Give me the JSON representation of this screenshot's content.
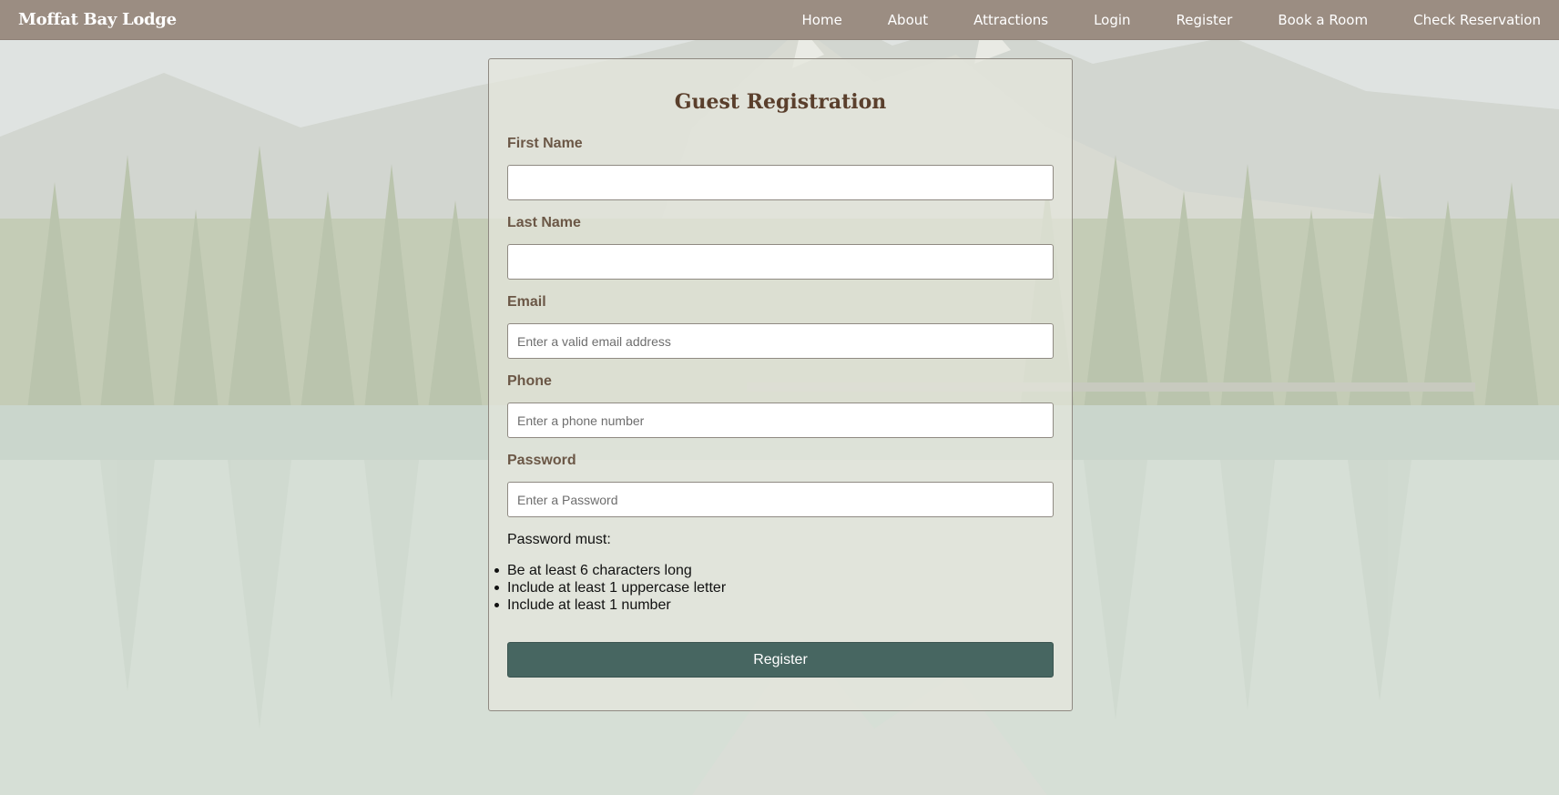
{
  "nav": {
    "brand": "Moffat Bay Lodge",
    "links": [
      {
        "label": "Home"
      },
      {
        "label": "About"
      },
      {
        "label": "Attractions"
      },
      {
        "label": "Login"
      },
      {
        "label": "Register"
      },
      {
        "label": "Book a Room"
      },
      {
        "label": "Check Reservation"
      }
    ]
  },
  "form": {
    "title": "Guest Registration",
    "fields": [
      {
        "label": "First Name",
        "value": "",
        "placeholder": ""
      },
      {
        "label": "Last Name",
        "value": "",
        "placeholder": ""
      },
      {
        "label": "Email",
        "value": "",
        "placeholder": "Enter a valid email address"
      },
      {
        "label": "Phone",
        "value": "",
        "placeholder": "Enter a phone number"
      },
      {
        "label": "Password",
        "value": "",
        "placeholder": "Enter a Password"
      }
    ],
    "password_rules_title": "Password must:",
    "password_rules": [
      "Be at least 6 characters long",
      "Include at least 1 uppercase letter",
      "Include at least 1 number"
    ],
    "submit_label": "Register"
  },
  "colors": {
    "navbar": "#9b8d82",
    "button": "#476661",
    "title": "#5a3f2c",
    "label": "#6b5746"
  }
}
